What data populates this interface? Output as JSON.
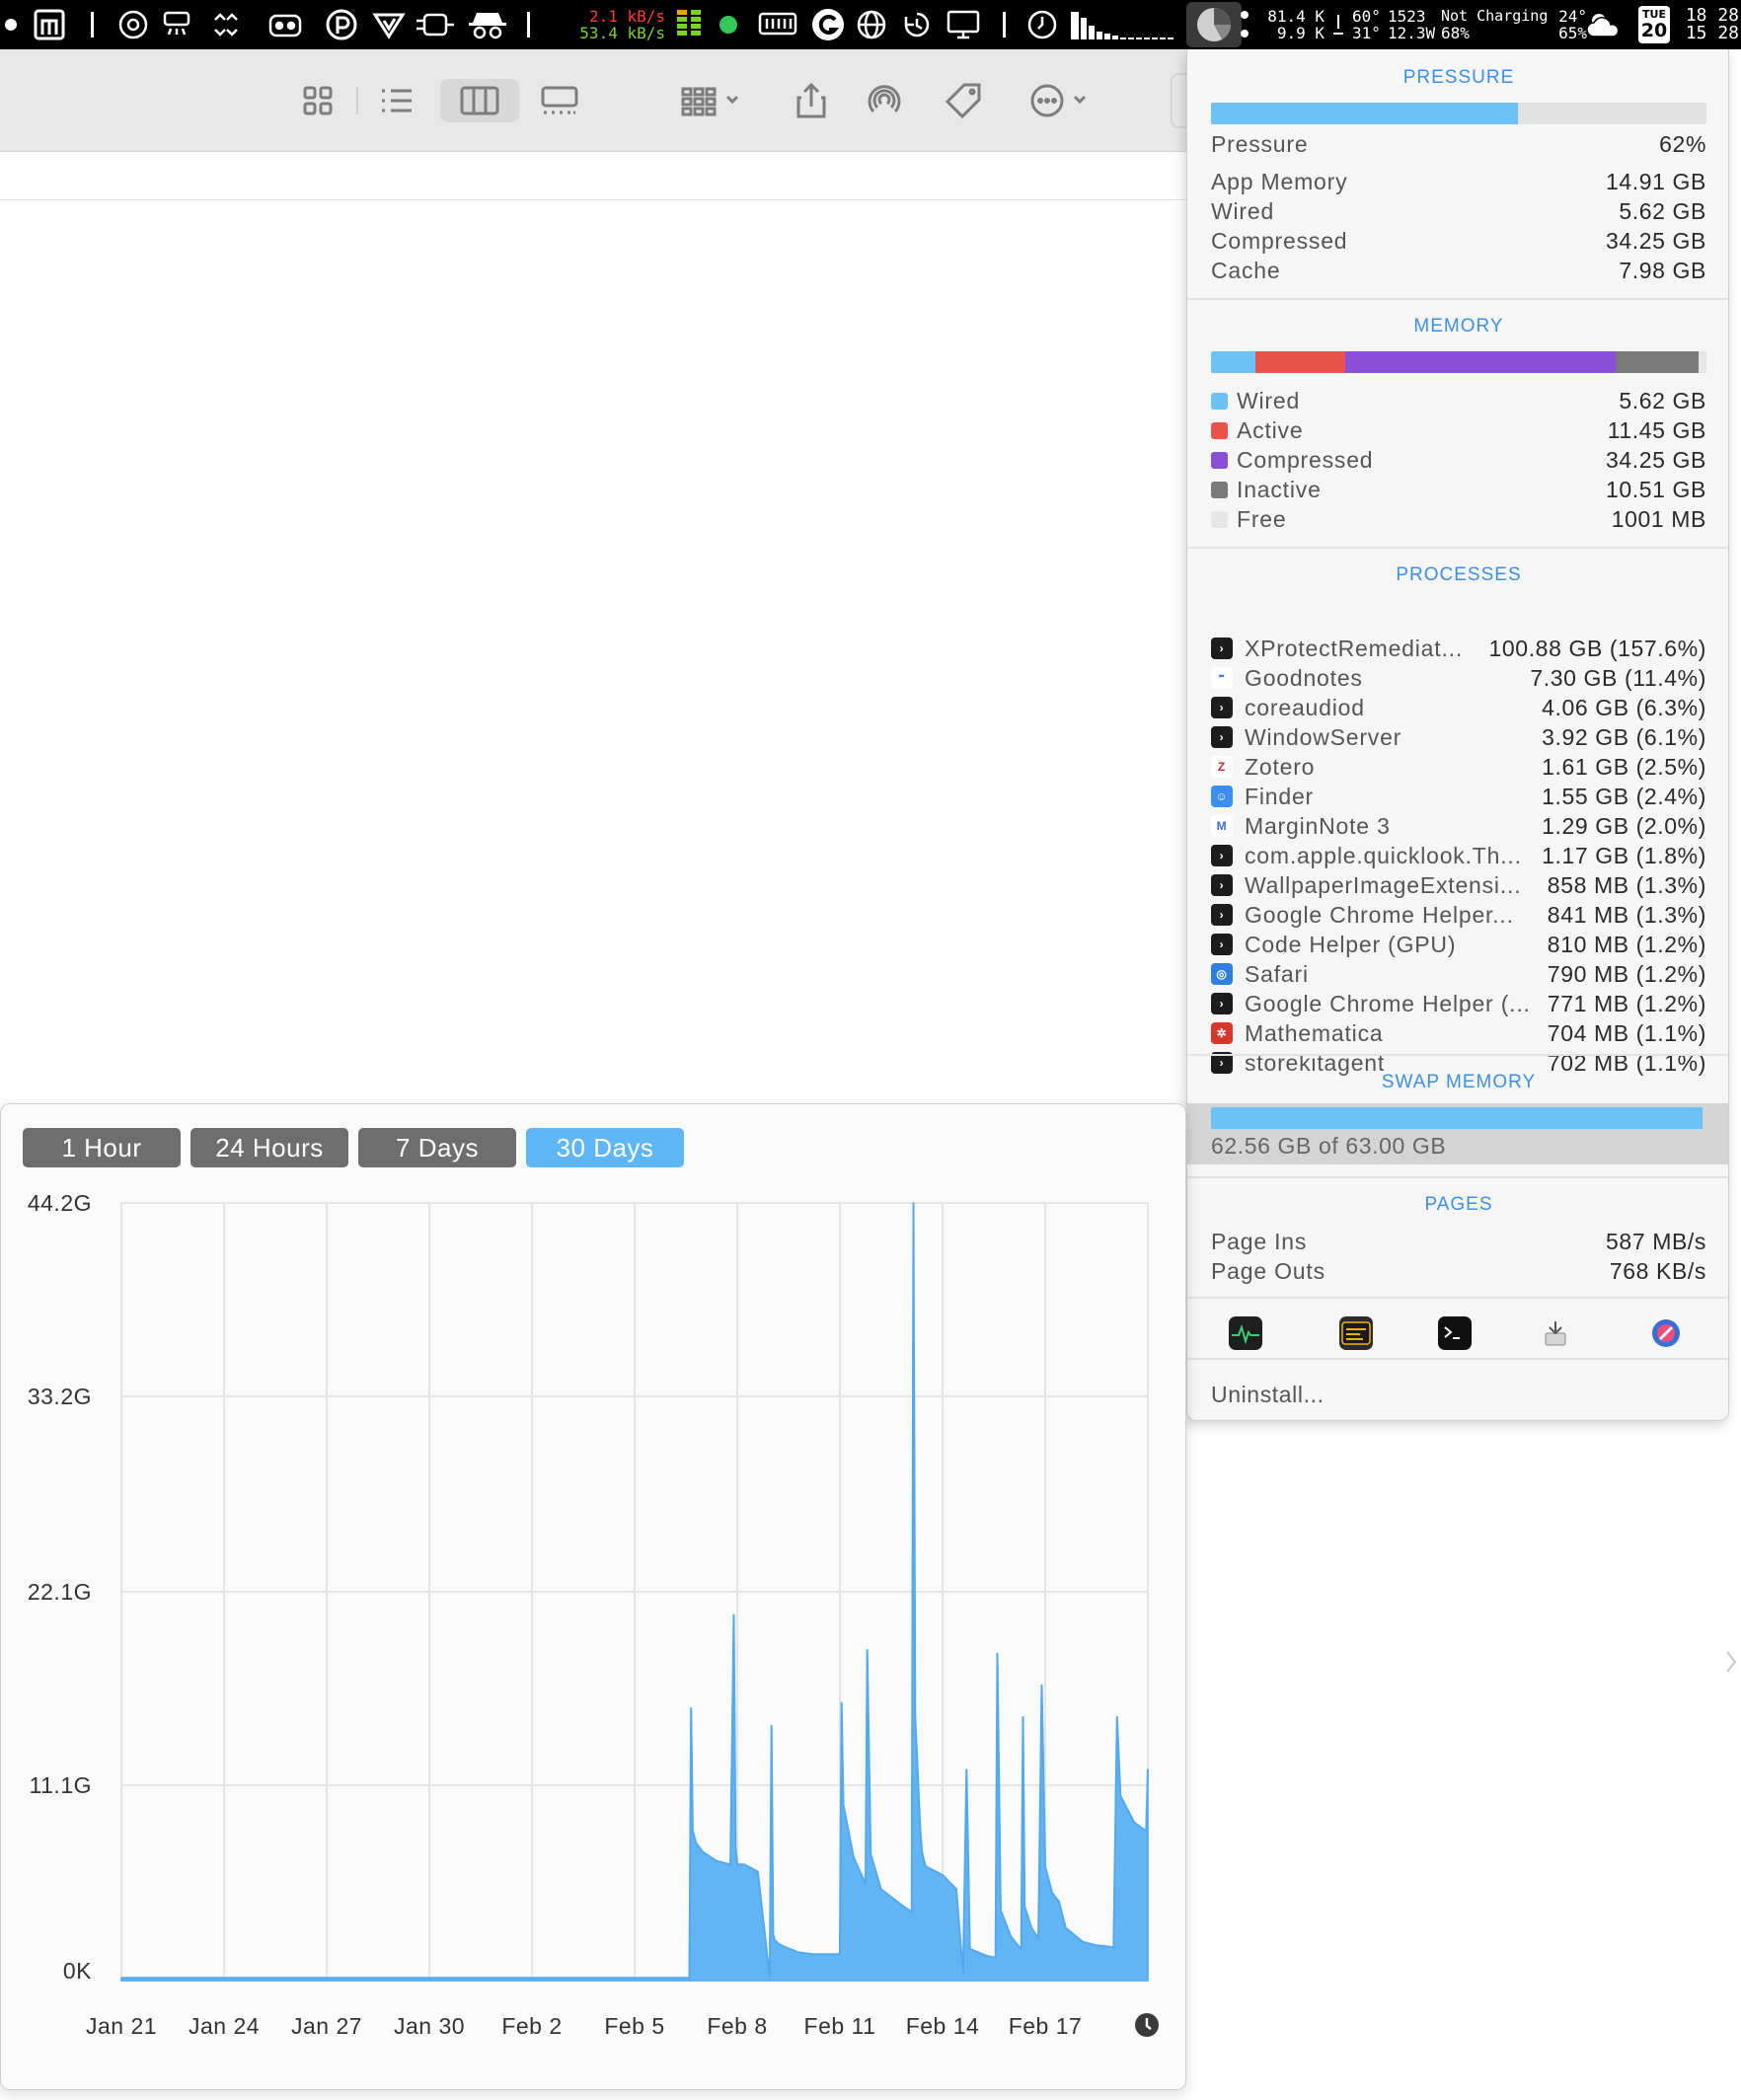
{
  "menubar": {
    "network": {
      "upload": "2.1 kB/s",
      "download": "53.4 kB/s",
      "upload_color": "#ff3b30",
      "download_color": "#7bd321"
    },
    "disk": {
      "read": "81.4 K",
      "write": "9.9 K"
    },
    "sensors": {
      "temp1": "60°",
      "temp2": "31°",
      "fan": "1523",
      "power": "12.3W"
    },
    "battery": {
      "status": "Not Charging",
      "percent": "68%"
    },
    "weather": {
      "temp": "24°",
      "humidity": "65%"
    },
    "calendar": {
      "weekday": "TUE",
      "day": "20"
    },
    "clock": {
      "line1": "18 28",
      "line2": "15 28"
    }
  },
  "popover": {
    "pressure": {
      "title": "PRESSURE",
      "fraction": 0.62,
      "rows": [
        {
          "label": "Pressure",
          "value": "62%"
        },
        {
          "label": "App Memory",
          "value": "14.91 GB"
        },
        {
          "label": "Wired",
          "value": "5.62 GB"
        },
        {
          "label": "Compressed",
          "value": "34.25 GB"
        },
        {
          "label": "Cache",
          "value": "7.98 GB"
        }
      ]
    },
    "memory": {
      "title": "MEMORY",
      "legend": [
        {
          "label": "Wired",
          "value": "5.62 GB",
          "color": "#6cc2f7",
          "gb": 5.62
        },
        {
          "label": "Active",
          "value": "11.45 GB",
          "color": "#e8544a",
          "gb": 11.45
        },
        {
          "label": "Compressed",
          "value": "34.25 GB",
          "color": "#8a4fd8",
          "gb": 34.25
        },
        {
          "label": "Inactive",
          "value": "10.51 GB",
          "color": "#7a7a7a",
          "gb": 10.51
        },
        {
          "label": "Free",
          "value": "1001 MB",
          "color": "#e6e6e6",
          "gb": 0.98
        }
      ]
    },
    "processes": {
      "title": "PROCESSES",
      "items": [
        {
          "name": "XProtectRemediat...",
          "value": "100.88 GB (157.6%)",
          "icon": "terminal-icon"
        },
        {
          "name": "Goodnotes",
          "value": "7.30 GB (11.4%)",
          "icon": "goodnotes-icon"
        },
        {
          "name": "coreaudiod",
          "value": "4.06 GB (6.3%)",
          "icon": "terminal-icon"
        },
        {
          "name": "WindowServer",
          "value": "3.92 GB (6.1%)",
          "icon": "terminal-icon"
        },
        {
          "name": "Zotero",
          "value": "1.61 GB (2.5%)",
          "icon": "zotero-icon"
        },
        {
          "name": "Finder",
          "value": "1.55 GB (2.4%)",
          "icon": "finder-icon"
        },
        {
          "name": "MarginNote 3",
          "value": "1.29 GB (2.0%)",
          "icon": "marginnote-icon"
        },
        {
          "name": "com.apple.quicklook.Th...",
          "value": "1.17 GB (1.8%)",
          "icon": "terminal-icon"
        },
        {
          "name": "WallpaperImageExtensi...",
          "value": "858 MB (1.3%)",
          "icon": "terminal-icon"
        },
        {
          "name": "Google Chrome Helper...",
          "value": "841 MB (1.3%)",
          "icon": "terminal-icon"
        },
        {
          "name": "Code Helper (GPU)",
          "value": "810 MB (1.2%)",
          "icon": "terminal-icon"
        },
        {
          "name": "Safari",
          "value": "790 MB (1.2%)",
          "icon": "safari-icon"
        },
        {
          "name": "Google Chrome Helper (...",
          "value": "771 MB (1.2%)",
          "icon": "terminal-icon"
        },
        {
          "name": "Mathematica",
          "value": "704 MB (1.1%)",
          "icon": "mathematica-icon"
        },
        {
          "name": "storekitagent",
          "value": "702 MB (1.1%)",
          "icon": "terminal-icon"
        }
      ]
    },
    "swap": {
      "title": "SWAP MEMORY",
      "used_fraction": 0.993,
      "text": "62.56 GB of 63.00 GB"
    },
    "pages": {
      "title": "PAGES",
      "rows": [
        {
          "label": "Page Ins",
          "value": "587 MB/s"
        },
        {
          "label": "Page Outs",
          "value": "768 KB/s"
        }
      ]
    },
    "launchers": [
      "activity-monitor-icon",
      "console-icon",
      "terminal-icon",
      "system-information-icon",
      "disk-utility-icon"
    ],
    "uninstall_label": "Uninstall..."
  },
  "chart_window": {
    "ranges": [
      {
        "label": "1 Hour",
        "active": false
      },
      {
        "label": "24 Hours",
        "active": false
      },
      {
        "label": "7 Days",
        "active": false
      },
      {
        "label": "30 Days",
        "active": true
      }
    ]
  },
  "chart_data": {
    "type": "area",
    "title": "",
    "xlabel": "",
    "ylabel": "",
    "color": "#62b5f2",
    "grid": true,
    "y_ticks": [
      {
        "value": 0,
        "label": "0K"
      },
      {
        "value": 11.1,
        "label": "11.1G"
      },
      {
        "value": 22.1,
        "label": "22.1G"
      },
      {
        "value": 33.2,
        "label": "33.2G"
      },
      {
        "value": 44.2,
        "label": "44.2G"
      }
    ],
    "ylim": [
      0,
      44.2
    ],
    "x_ticks": [
      {
        "value": 0,
        "label": "Jan 21"
      },
      {
        "value": 3,
        "label": "Jan 24"
      },
      {
        "value": 6,
        "label": "Jan 27"
      },
      {
        "value": 9,
        "label": "Jan 30"
      },
      {
        "value": 12,
        "label": "Feb 2"
      },
      {
        "value": 15,
        "label": "Feb 5"
      },
      {
        "value": 18,
        "label": "Feb 8"
      },
      {
        "value": 21,
        "label": "Feb 11"
      },
      {
        "value": 24,
        "label": "Feb 14"
      },
      {
        "value": 27,
        "label": "Feb 17"
      }
    ],
    "xlim": [
      0,
      30
    ],
    "series": [
      {
        "x": [
          0,
          16.6,
          16.65,
          16.7,
          16.8,
          17.0,
          17.4,
          17.8,
          17.9,
          17.95,
          18.0,
          18.2,
          18.6,
          18.95,
          19.0,
          19.05,
          19.1,
          19.2,
          19.4,
          19.8,
          20.2,
          20.6,
          21.0,
          21.05,
          21.1,
          21.4,
          21.75,
          21.8,
          21.9,
          22.2,
          22.8,
          23.1,
          23.15,
          23.2,
          23.35,
          23.4,
          23.5,
          24.0,
          24.4,
          24.6,
          24.7,
          24.8,
          25.3,
          25.55,
          25.6,
          25.7,
          26.0,
          26.2,
          26.3,
          26.35,
          26.4,
          26.6,
          26.8,
          26.9,
          27.0,
          27.2,
          27.4,
          27.6,
          28.1,
          28.5,
          29.0,
          29.1,
          29.2,
          29.6,
          29.95,
          30.0
        ],
        "y": [
          0.15,
          0.15,
          15.5,
          8.5,
          7.8,
          7.3,
          6.8,
          6.6,
          20.8,
          7.6,
          6.6,
          6.6,
          6.2,
          0.15,
          14.5,
          2.6,
          2.3,
          2.1,
          1.9,
          1.6,
          1.5,
          1.5,
          1.5,
          15.8,
          10.0,
          7.0,
          5.5,
          18.8,
          7.2,
          5.2,
          4.3,
          3.9,
          44.2,
          15.0,
          8.5,
          7.3,
          6.5,
          6.0,
          5.2,
          0.4,
          12.0,
          1.8,
          1.4,
          1.3,
          18.6,
          4.0,
          2.5,
          2.0,
          1.8,
          15.0,
          4.2,
          3.0,
          2.4,
          16.8,
          6.5,
          5.0,
          4.5,
          3.0,
          2.2,
          2.0,
          1.9,
          15.0,
          10.5,
          9.0,
          8.5,
          12.0
        ]
      }
    ]
  }
}
